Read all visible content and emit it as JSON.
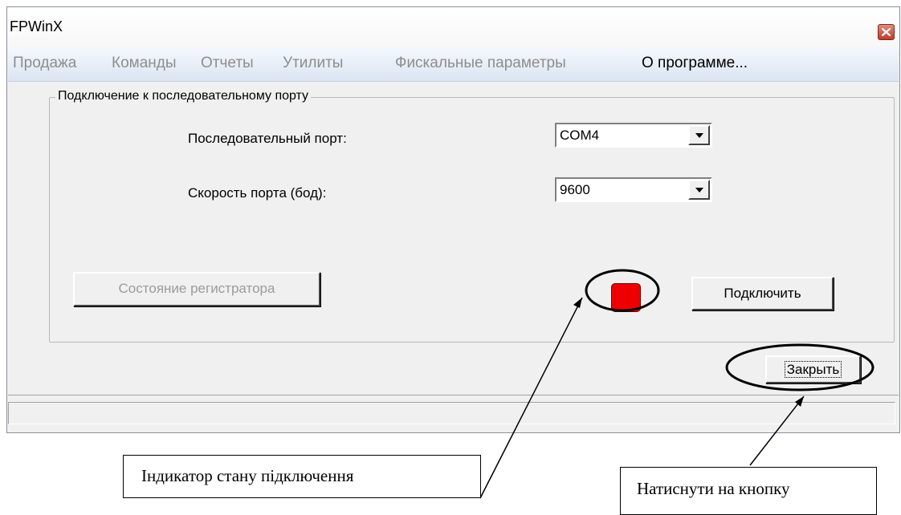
{
  "window": {
    "title": "FPWinX",
    "close_icon": "close-icon"
  },
  "menu": {
    "items": [
      {
        "label": "Продажа",
        "active": false
      },
      {
        "label": "Команды",
        "active": false
      },
      {
        "label": "Отчеты",
        "active": false
      },
      {
        "label": "Утилиты",
        "active": false
      },
      {
        "label": "Фискальные параметры",
        "active": false
      },
      {
        "label": "О программе...",
        "active": true
      }
    ]
  },
  "group": {
    "title": "Подключение к последовательному порту",
    "port_label": "Последовательный порт:",
    "port_value": "COM4",
    "baud_label": "Скорость порта (бод):",
    "baud_value": "9600",
    "state_button": "Состояние регистратора",
    "connect_button": "Подключить"
  },
  "indicator": {
    "color": "#ee0000",
    "description": "connection-status-indicator"
  },
  "close_button": "Закрыть",
  "annotations": {
    "indicator_callout": "Індикатор стану підключення",
    "button_callout": "Натиснути на кнопку"
  }
}
